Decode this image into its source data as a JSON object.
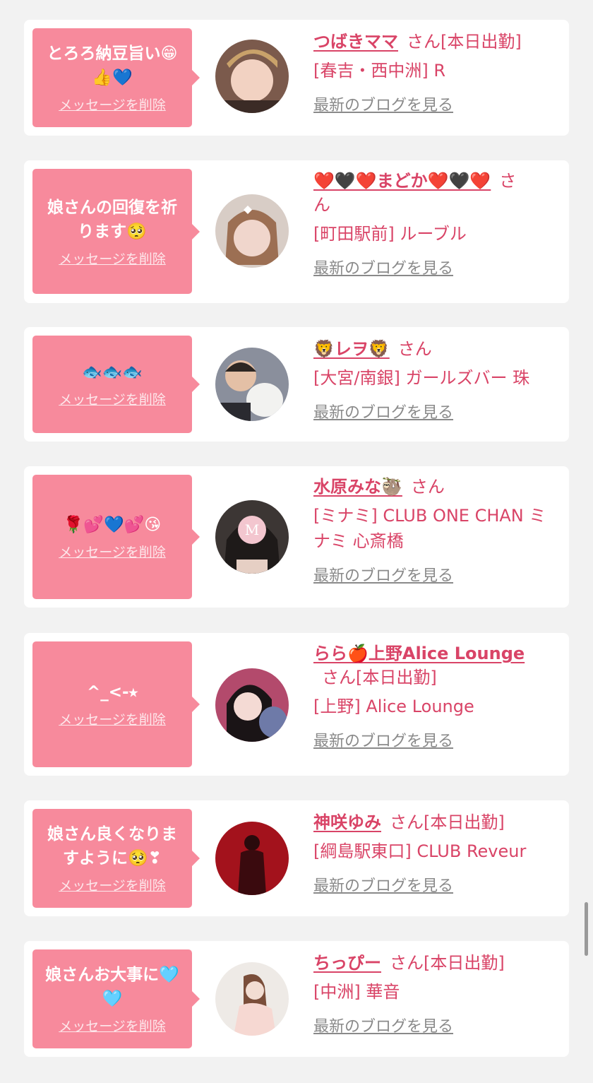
{
  "delete_label": "メッセージを削除",
  "blog_label": "最新のブログを見る",
  "san_label": "さん",
  "entries": [
    {
      "message": "とろろ納豆旨い😁\n👍💙",
      "name": "つばきママ",
      "status": "[本日出勤]",
      "shop": "[春吉・西中洲] R",
      "avatar": "avatar-photo-1"
    },
    {
      "message": "娘さんの回復を祈\nります🥺",
      "name": "❤️🖤❤️まどか❤️🖤❤️",
      "status": "",
      "shop": "[町田駅前] ルーブル",
      "avatar": "avatar-photo-2"
    },
    {
      "message": "🐟🐟🐟",
      "name": "🦁レヲ🦁",
      "status": "",
      "shop": "[大宮/南銀] ガールズバー 珠",
      "avatar": "avatar-photo-3"
    },
    {
      "message": "🌹💕💙💕😘",
      "name": "水原みな🦥",
      "status": "",
      "shop": "[ミナミ] CLUB ONE CHAN ミナミ 心斎橋",
      "avatar": "avatar-photo-4"
    },
    {
      "message": "^_<-⭑",
      "name": "らら🍎上野Alice Lounge",
      "status": "[本日出勤]",
      "shop": "[上野] Alice Lounge",
      "avatar": "avatar-photo-5"
    },
    {
      "message": "娘さん良くなりま\nすように🥺❣",
      "name": "神咲ゆみ",
      "status": "[本日出勤]",
      "shop": "[綱島駅東口] CLUB Reveur",
      "avatar": "avatar-photo-6"
    },
    {
      "message": "娘さんお大事に🩵\n🩵",
      "name": "ちっぴー",
      "status": "[本日出勤]",
      "shop": "[中洲] 華音",
      "avatar": "avatar-photo-7"
    }
  ],
  "colors": {
    "bubble": "#f78a9c",
    "name": "#d94467",
    "card": "#ffffff",
    "background": "#f2f2f2",
    "link_gray": "#8a8a8a"
  }
}
